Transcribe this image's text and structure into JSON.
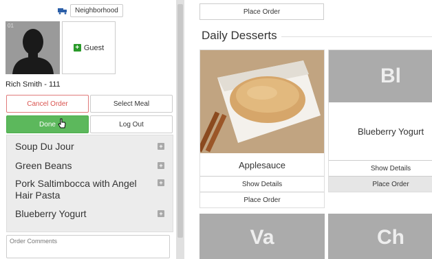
{
  "left": {
    "neighborhood_label": "Neighborhood",
    "avatar_id": "01",
    "guest_label": "Guest",
    "user_name": "Rich Smith - 111",
    "buttons": {
      "cancel_order": "Cancel Order",
      "select_meal": "Select Meal",
      "done": "Done",
      "log_out": "Log Out"
    },
    "meals": [
      {
        "label": "Soup Du Jour"
      },
      {
        "label": "Green Beans"
      },
      {
        "label": "Pork Saltimbocca with Angel Hair Pasta"
      },
      {
        "label": "Blueberry Yogurt"
      }
    ],
    "comments_placeholder": "Order Comments"
  },
  "right": {
    "top_place_order": "Place Order",
    "section_title": "Daily Desserts",
    "cards": [
      {
        "name": "Applesauce",
        "show_details": "Show Details",
        "place_order": "Place Order"
      },
      {
        "initials": "Bl",
        "name": "Blueberry Yogurt",
        "show_details": "Show Details",
        "place_order": "Place Order"
      }
    ],
    "bottom_cards": [
      {
        "initials": "Va"
      },
      {
        "initials": "Ch"
      }
    ]
  },
  "colors": {
    "done_green": "#5cb85c",
    "cancel_red": "#d9534f",
    "plus_green": "#2a9a2a",
    "placeholder_gray": "#ababab"
  }
}
